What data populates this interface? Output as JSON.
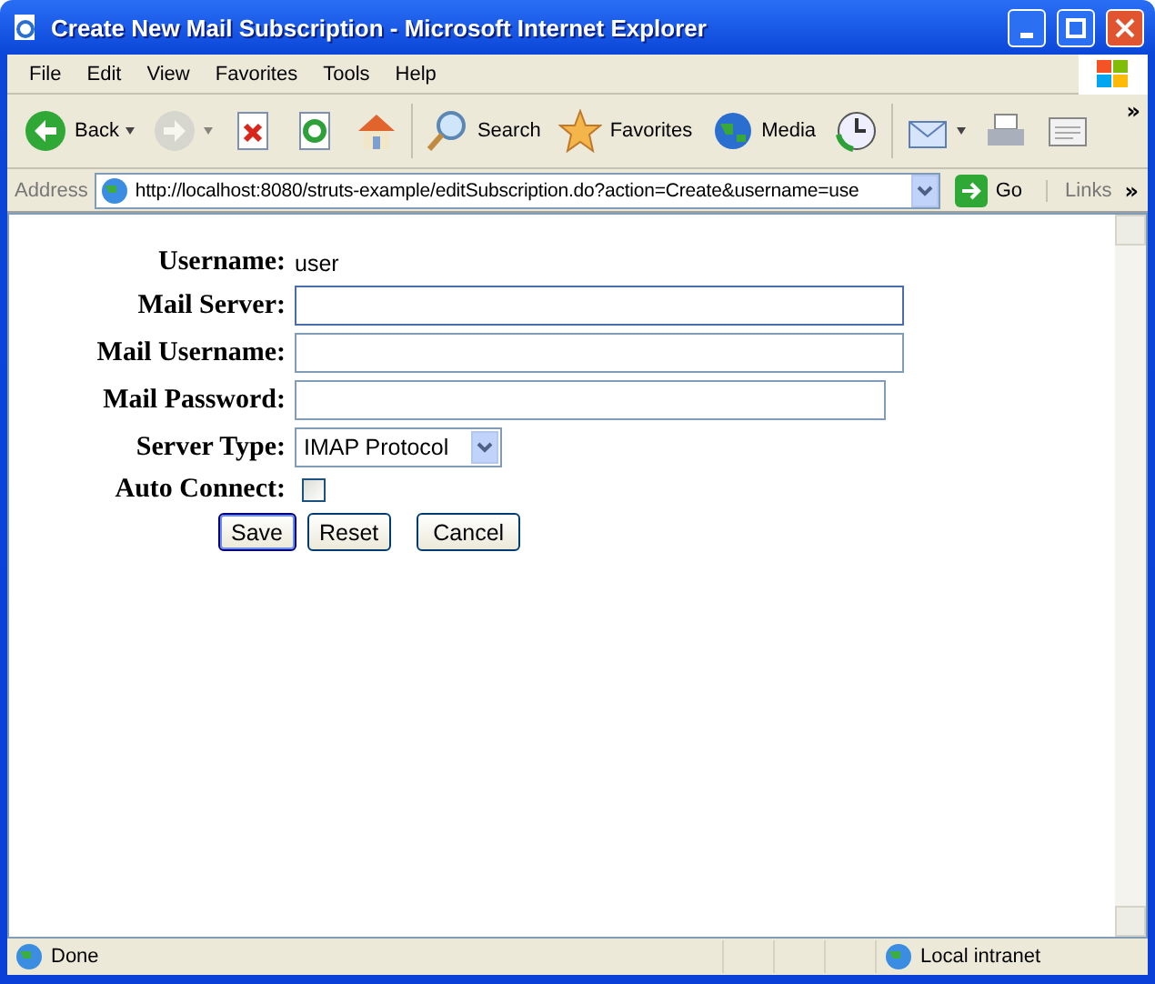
{
  "window": {
    "title": "Create New Mail Subscription - Microsoft Internet Explorer"
  },
  "menu": [
    "File",
    "Edit",
    "View",
    "Favorites",
    "Tools",
    "Help"
  ],
  "toolbar": [
    {
      "kind": "back",
      "label": "Back",
      "dropdown": true
    },
    {
      "kind": "forward",
      "dropdown": true,
      "disabled": true
    },
    {
      "kind": "stop"
    },
    {
      "kind": "refresh"
    },
    {
      "kind": "home"
    },
    {
      "kind": "search",
      "label": "Search"
    },
    {
      "kind": "favorites",
      "label": "Favorites"
    },
    {
      "kind": "media",
      "label": "Media"
    },
    {
      "kind": "history"
    },
    {
      "kind": "mail",
      "dropdown": true
    },
    {
      "kind": "print"
    },
    {
      "kind": "edit"
    }
  ],
  "toolbar_more": "»",
  "address": {
    "label": "Address",
    "url": "http://localhost:8080/struts-example/editSubscription.do?action=Create&username=use",
    "go": "Go",
    "links": "Links",
    "more": "»"
  },
  "form": {
    "rows": [
      {
        "kind": "static",
        "label": "Username:",
        "value": "user"
      },
      {
        "kind": "text",
        "label": "Mail Server:",
        "focused": true
      },
      {
        "kind": "text",
        "label": "Mail Username:",
        "focused": false
      },
      {
        "kind": "password",
        "label": "Mail Password:",
        "focused": false
      },
      {
        "kind": "select",
        "label": "Server Type:",
        "value": "IMAP Protocol"
      },
      {
        "kind": "checkbox",
        "label": "Auto Connect:",
        "checked": false
      }
    ],
    "buttons": [
      {
        "label": "Save",
        "default": true
      },
      {
        "label": "Reset",
        "default": false
      },
      {
        "label": "Cancel",
        "default": false
      }
    ]
  },
  "status": {
    "text": "Done",
    "zone": "Local intranet"
  }
}
